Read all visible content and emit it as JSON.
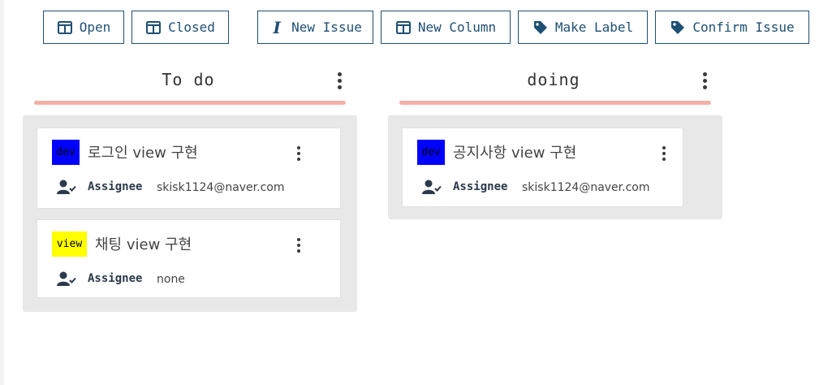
{
  "toolbar": {
    "open_label": "Open",
    "closed_label": "Closed",
    "new_issue_label": "New Issue",
    "new_column_label": "New Column",
    "make_label_label": "Make Label",
    "confirm_issue_label": "Confirm Issue"
  },
  "colors": {
    "accent": "#1e4f73",
    "column_bar": "#f2b1a5",
    "column_panel": "#e8e8e8",
    "label_dev": "#0000ff",
    "label_view": "#ffff00"
  },
  "columns": [
    {
      "title": "To do",
      "cards": [
        {
          "label": "dev",
          "label_color": "#0000ff",
          "title": "로그인 view 구현",
          "assignee_label": "Assignee",
          "assignee": "skisk1124@naver.com"
        },
        {
          "label": "view",
          "label_color": "#ffff00",
          "title": "채팅 view 구현",
          "assignee_label": "Assignee",
          "assignee": "none"
        }
      ]
    },
    {
      "title": "doing",
      "cards": [
        {
          "label": "dev",
          "label_color": "#0000ff",
          "title": "공지사항 view 구현",
          "assignee_label": "Assignee",
          "assignee": "skisk1124@naver.com"
        }
      ]
    }
  ]
}
